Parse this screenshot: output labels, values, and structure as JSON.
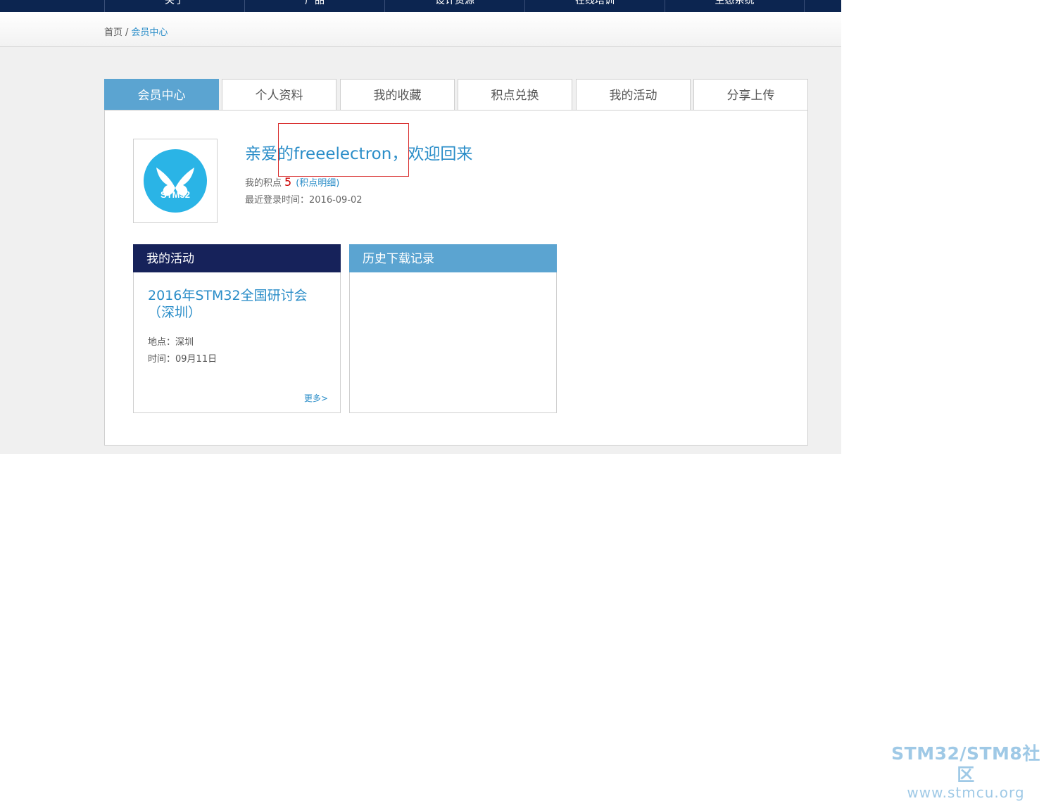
{
  "top_nav": {
    "items": [
      "关于",
      "产品",
      "设计资源",
      "在线培训",
      "生态系统"
    ]
  },
  "breadcrumb": {
    "home": "首页",
    "separator": "/",
    "current": "会员中心"
  },
  "tabs": [
    {
      "label": "会员中心",
      "active": true
    },
    {
      "label": "个人资料",
      "active": false
    },
    {
      "label": "我的收藏",
      "active": false
    },
    {
      "label": "积点兑换",
      "active": false
    },
    {
      "label": "我的活动",
      "active": false
    },
    {
      "label": "分享上传",
      "active": false
    }
  ],
  "profile": {
    "avatar_text": "STM32",
    "welcome_prefix": "亲爱的",
    "username": "freeelectron",
    "welcome_suffix": "，欢迎回来",
    "points_label": "我的积点",
    "points_value": "5",
    "points_open": "(",
    "points_detail_link": "积点明细",
    "points_close": ")",
    "last_login_label": "最近登录时间：",
    "last_login_value": "2016-09-02"
  },
  "activity_box": {
    "header": "我的活动",
    "event_title": "2016年STM32全国研讨会（深圳）",
    "place": "地点：深圳",
    "time": "时间：09月11日",
    "more": "更多>"
  },
  "history_box": {
    "header": "历史下载记录"
  },
  "watermark": {
    "brand": "STM32/STM8社区",
    "url": "www.stmcu.org"
  },
  "colors": {
    "nav_bg": "#0c2550",
    "accent_blue": "#2a8dc8",
    "tab_active": "#5ba4d1",
    "activity_header": "#16225a",
    "points_red": "#cc0000",
    "avatar_circle": "#2ab4e6"
  }
}
